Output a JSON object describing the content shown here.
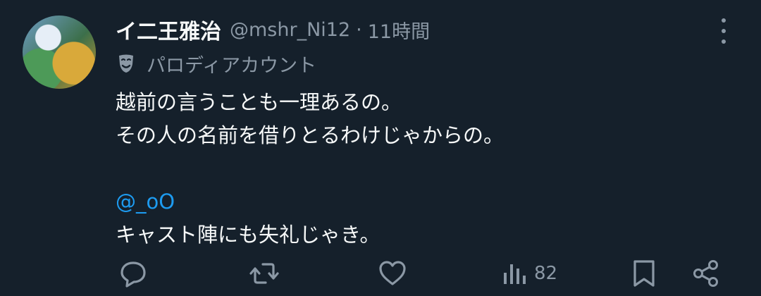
{
  "author": {
    "name": "イ二王雅治",
    "handle": "@mshr_Ni12",
    "separator": "·",
    "time": "11時間"
  },
  "parody_label": "パロディアカウント",
  "tweet": {
    "line1": "越前の言うことも一理あるの。",
    "line2": "その人の名前を借りとるわけじゃからの。",
    "mention": "@_oO",
    "line4": "キャスト陣にも失礼じゃき。"
  },
  "actions": {
    "views_count": "82"
  },
  "icons": {
    "more": "more-vertical-icon",
    "parody": "theater-mask-icon",
    "reply": "reply-icon",
    "retweet": "retweet-icon",
    "like": "heart-icon",
    "views": "views-icon",
    "bookmark": "bookmark-icon",
    "share": "share-icon"
  },
  "colors": {
    "background": "#15202b",
    "text": "#f7f9f9",
    "secondary": "#8b98a5",
    "link": "#1d9bf0"
  }
}
